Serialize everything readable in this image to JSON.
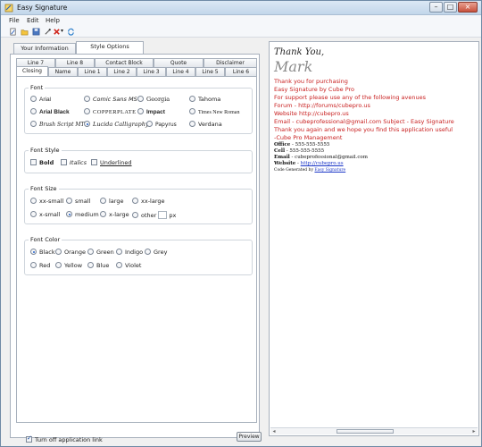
{
  "window": {
    "title": "Easy Signature"
  },
  "menu": {
    "items": [
      "File",
      "Edit",
      "Help"
    ]
  },
  "toolbar": {
    "icons": [
      "new-doc-icon",
      "folder-icon",
      "save-icon",
      "dropper-icon",
      "delete-icon",
      "refresh-icon"
    ]
  },
  "top_tabs": [
    "Your Information",
    "Style Options"
  ],
  "subtabs_row1": [
    "Line 7",
    "Line 8",
    "Contact Block",
    "Quote",
    "Disclaimer"
  ],
  "subtabs_row2": [
    "Closing",
    "Name",
    "Line 1",
    "Line 2",
    "Line 3",
    "Line 4",
    "Line 5",
    "Line 6"
  ],
  "font_group": {
    "title": "Font",
    "options": [
      "Arial",
      "Comic Sans MS",
      "Georgia",
      "Tahoma",
      "Arial Black",
      "COPPERPLATE",
      "Impact",
      "Times New Roman",
      "Brush Script MT",
      "Lucida Calligraphy",
      "Papyrus",
      "Verdana"
    ],
    "selected": "Lucida Calligraphy"
  },
  "font_style_group": {
    "title": "Font Style",
    "options": [
      "Bold",
      "Italics",
      "Underlined"
    ]
  },
  "font_size_group": {
    "title": "Font Size",
    "options": [
      "xx-small",
      "small",
      "large",
      "xx-large",
      "x-small",
      "medium",
      "x-large",
      "other"
    ],
    "selected": "medium",
    "px_label": "px"
  },
  "font_color_group": {
    "title": "Font Color",
    "options": [
      "Black",
      "Orange",
      "Green",
      "Indigo",
      "Grey",
      "Red",
      "Yellow",
      "Blue",
      "Violet"
    ],
    "selected": "Black"
  },
  "footer": {
    "turn_off_link": "Turn off application link",
    "preview_button": "Preview"
  },
  "signature": {
    "thank": "Thank You,",
    "name": "Mark",
    "lines": [
      "Thank you for purchasing",
      "Easy Signature by Cube Pro",
      "For support please use any of the following avenues",
      "Forum - http://forums/cubepro.us",
      "Website http://cubepro.us",
      "Email - cubeprofessional@gmail.com Subject - Easy Signature",
      "Thank you again and we hope you find this application useful",
      "-Cube Pro Management"
    ],
    "office_label": "Office",
    "office_value": " - 555-555-5555",
    "cell_label": "Cell",
    "cell_value": " - 555-555-5555",
    "email_label": "Email",
    "email_value": " - cubeprofessional@gmail.com",
    "website_label": "Website",
    "website_value": "http://cubepro.us",
    "code_text": "Code Generated by ",
    "code_link": "Easy Signature"
  },
  "colors": {
    "accent": "#c81e1e",
    "link": "#1a35c7"
  }
}
